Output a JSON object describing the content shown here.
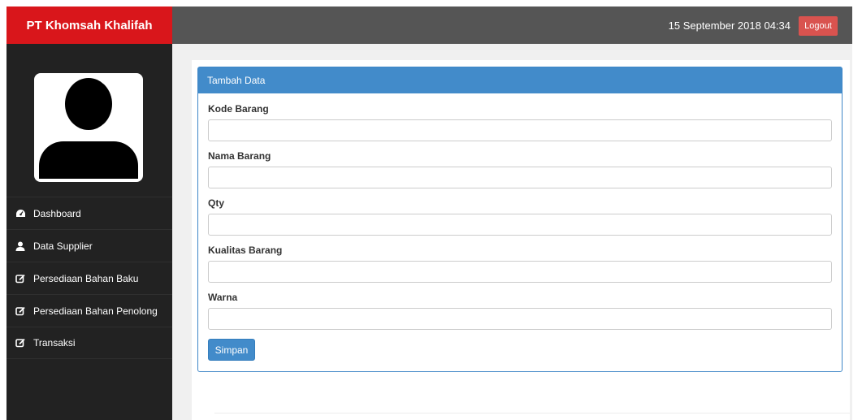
{
  "sidebar": {
    "brand": "PT Khomsah Khalifah",
    "items": [
      {
        "label": "Dashboard",
        "icon": "dashboard-icon"
      },
      {
        "label": "Data Supplier",
        "icon": "user-icon"
      },
      {
        "label": "Persediaan Bahan Baku",
        "icon": "edit-icon"
      },
      {
        "label": "Persediaan Bahan Penolong",
        "icon": "edit-icon"
      },
      {
        "label": "Transaksi",
        "icon": "edit-icon"
      }
    ]
  },
  "header": {
    "datetime": "15 September 2018 04:34",
    "logout_label": "Logout"
  },
  "form": {
    "title": "Tambah Data",
    "fields": [
      {
        "label": "Kode Barang",
        "value": ""
      },
      {
        "label": "Nama Barang",
        "value": ""
      },
      {
        "label": "Qty",
        "value": ""
      },
      {
        "label": "Kualitas Barang",
        "value": ""
      },
      {
        "label": "Warna",
        "value": ""
      }
    ],
    "submit_label": "Simpan"
  },
  "colors": {
    "brand": "#d9161b",
    "sidebar": "#222222",
    "header": "#555555",
    "primary": "#428bca",
    "danger": "#d9534f"
  }
}
